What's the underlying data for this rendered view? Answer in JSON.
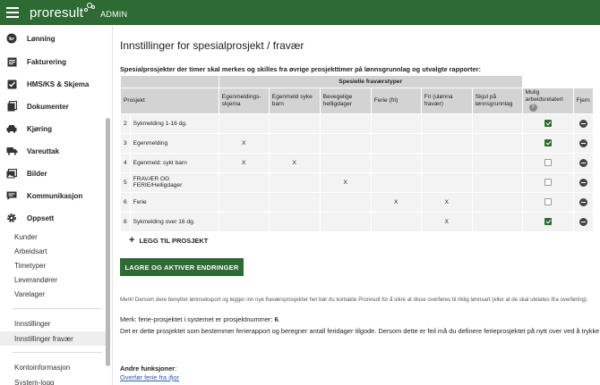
{
  "header": {
    "brand": "proresult",
    "admin_label": "ADMIN"
  },
  "sidebar": {
    "items": [
      {
        "label": "Lønning",
        "icon": "money-circle-icon"
      },
      {
        "label": "Fakturering",
        "icon": "invoice-icon"
      },
      {
        "label": "HMS/KS & Skjema",
        "icon": "checkbox-icon"
      },
      {
        "label": "Dokumenter",
        "icon": "documents-icon"
      },
      {
        "label": "Kjøring",
        "icon": "car-icon"
      },
      {
        "label": "Vareuttak",
        "icon": "truck-icon"
      },
      {
        "label": "Bilder",
        "icon": "images-icon"
      },
      {
        "label": "Kommunikasjon",
        "icon": "chat-icon"
      },
      {
        "label": "Oppsett",
        "icon": "gear-icon"
      }
    ],
    "sub_items": [
      "Kunder",
      "Arbeidsart",
      "Timetyper",
      "Leverandører",
      "Varelager"
    ],
    "settings_items": [
      "Innstillinger",
      "Innstillinger fravær"
    ],
    "bottom_items": [
      "Kontoinformasjon",
      "System-logg"
    ]
  },
  "main": {
    "title": "Innstillinger for spesialprosjekt / fravær",
    "description": "Spesialprosjekter der timer skal merkes og skilles fra øvrige prosjekttimer på lønnsgrunnlag og utvalgte rapporter:",
    "table": {
      "group_header": "Spesielle fraværstyper",
      "columns": {
        "project": "Prosjekt",
        "c1": "Egenmeldings-skjema",
        "c2": "Egenmeld syke barn",
        "c3": "Bevegelige helligdager",
        "c4": "Ferie (fri)",
        "c5": "Fri (ulønna fravær)",
        "c6": "Skjul på lønnsgrunnlag",
        "c7": "Mulig arbeidsrelatert",
        "c8": "Fjern"
      },
      "rows": [
        {
          "num": "2",
          "name": "Sykmelding 1-16 dg.",
          "c1": "",
          "c2": "",
          "c3": "",
          "c4": "",
          "c5": "",
          "c6": "",
          "arbeid": true
        },
        {
          "num": "3",
          "name": "Egenmelding",
          "c1": "X",
          "c2": "",
          "c3": "",
          "c4": "",
          "c5": "",
          "c6": "",
          "arbeid": true
        },
        {
          "num": "4",
          "name": "Egenmeld: sykt barn",
          "c1": "X",
          "c2": "X",
          "c3": "",
          "c4": "",
          "c5": "",
          "c6": "",
          "arbeid": false
        },
        {
          "num": "5",
          "name": "FRAVÆR OG FERIE/Helligdager",
          "c1": "",
          "c2": "",
          "c3": "X",
          "c4": "",
          "c5": "",
          "c6": "",
          "arbeid": false
        },
        {
          "num": "6",
          "name": "Ferie",
          "c1": "",
          "c2": "",
          "c3": "",
          "c4": "X",
          "c5": "X",
          "c6": "",
          "arbeid": false
        },
        {
          "num": "8",
          "name": "Sykmelding over 16 dg.",
          "c1": "",
          "c2": "",
          "c3": "",
          "c4": "",
          "c5": "X",
          "c6": "",
          "arbeid": true
        }
      ]
    },
    "add_label": "LEGG TIL PROSJEKT",
    "save_label": "LAGRE OG AKTIVER ENDRINGER",
    "note": "Merk! Dersom dere benytter lønnseksport og legger inn nye fraværsprosjekter her bør du kontakte Proresult for å sikre at disse overføres til riktig lønnsart (eller at de skal utelates ifra overføring).",
    "ferie_prefix": "Merk: ferie-prosjektet i systemet er prosjektnummer:",
    "ferie_number": "6",
    "ferie_suffix": ".",
    "ferie_desc": "Det er dette prosjektet som bestemmer ferierapport og beregner antall feridager tilgode. Dersom dette er feil må du definere ferieprosjektet på nytt over ved å trykke på knappen.",
    "other_heading": "Andre funksjoner",
    "other_colon": ":",
    "other_link": "Overfør ferie fra ifjor"
  },
  "colors": {
    "brand_green": "#2e6b34",
    "link_blue": "#2f5da8"
  }
}
